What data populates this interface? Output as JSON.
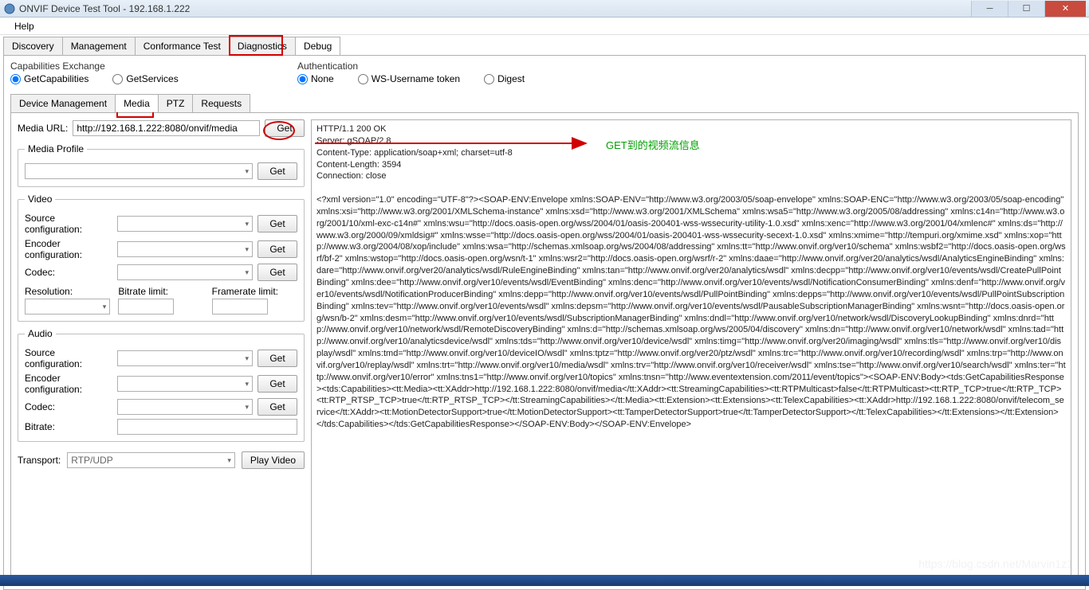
{
  "window": {
    "title": "ONVIF Device Test Tool - 192.168.1.222"
  },
  "menu": {
    "help": "Help"
  },
  "toptabs": {
    "discovery": "Discovery",
    "management": "Management",
    "conformance": "Conformance Test",
    "diagnostics": "Diagnostics",
    "debug": "Debug"
  },
  "capex": {
    "header": "Capabilities Exchange",
    "getcap": "GetCapabilities",
    "getsvc": "GetServices"
  },
  "auth": {
    "header": "Authentication",
    "none": "None",
    "ws": "WS-Username token",
    "digest": "Digest"
  },
  "subtabs": {
    "devmgmt": "Device Management",
    "media": "Media",
    "ptz": "PTZ",
    "requests": "Requests"
  },
  "mediaurl": {
    "label": "Media URL:",
    "value": "http://192.168.1.222:8080/onvif/media",
    "get": "Get"
  },
  "profile": {
    "legend": "Media Profile",
    "get": "Get"
  },
  "video": {
    "legend": "Video",
    "srccfg": "Source configuration:",
    "enccfg": "Encoder configuration:",
    "codec": "Codec:",
    "res": "Resolution:",
    "bitrate": "Bitrate limit:",
    "framerate": "Framerate limit:",
    "get": "Get"
  },
  "audio": {
    "legend": "Audio",
    "srccfg": "Source configuration:",
    "enccfg": "Encoder configuration:",
    "codec": "Codec:",
    "bitrate": "Bitrate:",
    "get": "Get"
  },
  "transport": {
    "label": "Transport:",
    "value": "RTP/UDP",
    "play": "Play Video"
  },
  "annotation": {
    "greentext": "GET到的视频流信息"
  },
  "watermark": "https://blog.csdn.net/Marvin1z1",
  "response": "HTTP/1.1 200 OK\nServer: gSOAP/2.8\nContent-Type: application/soap+xml; charset=utf-8\nContent-Length: 3594\nConnection: close\n\n<?xml version=\"1.0\" encoding=\"UTF-8\"?><SOAP-ENV:Envelope xmlns:SOAP-ENV=\"http://www.w3.org/2003/05/soap-envelope\" xmlns:SOAP-ENC=\"http://www.w3.org/2003/05/soap-encoding\" xmlns:xsi=\"http://www.w3.org/2001/XMLSchema-instance\" xmlns:xsd=\"http://www.w3.org/2001/XMLSchema\" xmlns:wsa5=\"http://www.w3.org/2005/08/addressing\" xmlns:c14n=\"http://www.w3.org/2001/10/xml-exc-c14n#\" xmlns:wsu=\"http://docs.oasis-open.org/wss/2004/01/oasis-200401-wss-wssecurity-utility-1.0.xsd\" xmlns:xenc=\"http://www.w3.org/2001/04/xmlenc#\" xmlns:ds=\"http://www.w3.org/2000/09/xmldsig#\" xmlns:wsse=\"http://docs.oasis-open.org/wss/2004/01/oasis-200401-wss-wssecurity-secext-1.0.xsd\" xmlns:xmime=\"http://tempuri.org/xmime.xsd\" xmlns:xop=\"http://www.w3.org/2004/08/xop/include\" xmlns:wsa=\"http://schemas.xmlsoap.org/ws/2004/08/addressing\" xmlns:tt=\"http://www.onvif.org/ver10/schema\" xmlns:wsbf2=\"http://docs.oasis-open.org/wsrf/bf-2\" xmlns:wstop=\"http://docs.oasis-open.org/wsn/t-1\" xmlns:wsr2=\"http://docs.oasis-open.org/wsrf/r-2\" xmlns:daae=\"http://www.onvif.org/ver20/analytics/wsdl/AnalyticsEngineBinding\" xmlns:dare=\"http://www.onvif.org/ver20/analytics/wsdl/RuleEngineBinding\" xmlns:tan=\"http://www.onvif.org/ver20/analytics/wsdl\" xmlns:decpp=\"http://www.onvif.org/ver10/events/wsdl/CreatePullPointBinding\" xmlns:dee=\"http://www.onvif.org/ver10/events/wsdl/EventBinding\" xmlns:denc=\"http://www.onvif.org/ver10/events/wsdl/NotificationConsumerBinding\" xmlns:denf=\"http://www.onvif.org/ver10/events/wsdl/NotificationProducerBinding\" xmlns:depp=\"http://www.onvif.org/ver10/events/wsdl/PullPointBinding\" xmlns:depps=\"http://www.onvif.org/ver10/events/wsdl/PullPointSubscriptionBinding\" xmlns:tev=\"http://www.onvif.org/ver10/events/wsdl\" xmlns:depsm=\"http://www.onvif.org/ver10/events/wsdl/PausableSubscriptionManagerBinding\" xmlns:wsnt=\"http://docs.oasis-open.org/wsn/b-2\" xmlns:desm=\"http://www.onvif.org/ver10/events/wsdl/SubscriptionManagerBinding\" xmlns:dndl=\"http://www.onvif.org/ver10/network/wsdl/DiscoveryLookupBinding\" xmlns:dnrd=\"http://www.onvif.org/ver10/network/wsdl/RemoteDiscoveryBinding\" xmlns:d=\"http://schemas.xmlsoap.org/ws/2005/04/discovery\" xmlns:dn=\"http://www.onvif.org/ver10/network/wsdl\" xmlns:tad=\"http://www.onvif.org/ver10/analyticsdevice/wsdl\" xmlns:tds=\"http://www.onvif.org/ver10/device/wsdl\" xmlns:timg=\"http://www.onvif.org/ver20/imaging/wsdl\" xmlns:tls=\"http://www.onvif.org/ver10/display/wsdl\" xmlns:tmd=\"http://www.onvif.org/ver10/deviceIO/wsdl\" xmlns:tptz=\"http://www.onvif.org/ver20/ptz/wsdl\" xmlns:trc=\"http://www.onvif.org/ver10/recording/wsdl\" xmlns:trp=\"http://www.onvif.org/ver10/replay/wsdl\" xmlns:trt=\"http://www.onvif.org/ver10/media/wsdl\" xmlns:trv=\"http://www.onvif.org/ver10/receiver/wsdl\" xmlns:tse=\"http://www.onvif.org/ver10/search/wsdl\" xmlns:ter=\"http://www.onvif.org/ver10/error\" xmlns:tns1=\"http://www.onvif.org/ver10/topics\" xmlns:tnsn=\"http://www.eventextension.com/2011/event/topics\"><SOAP-ENV:Body><tds:GetCapabilitiesResponse><tds:Capabilities><tt:Media><tt:XAddr>http://192.168.1.222:8080/onvif/media</tt:XAddr><tt:StreamingCapabilities><tt:RTPMulticast>false</tt:RTPMulticast><tt:RTP_TCP>true</tt:RTP_TCP><tt:RTP_RTSP_TCP>true</tt:RTP_RTSP_TCP></tt:StreamingCapabilities></tt:Media><tt:Extension><tt:Extensions><tt:TelexCapabilities><tt:XAddr>http://192.168.1.222:8080/onvif/telecom_service</tt:XAddr><tt:MotionDetectorSupport>true</tt:MotionDetectorSupport><tt:TamperDetectorSupport>true</tt:TamperDetectorSupport></tt:TelexCapabilities></tt:Extensions></tt:Extension></tds:Capabilities></tds:GetCapabilitiesResponse></SOAP-ENV:Body></SOAP-ENV:Envelope>"
}
